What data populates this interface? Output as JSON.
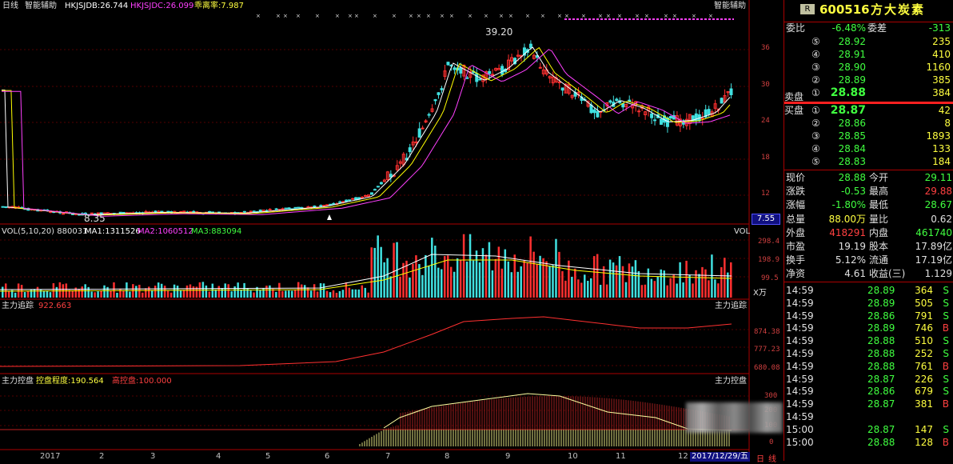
{
  "chart": {
    "period_label": "日线",
    "assist_label": "智能辅助",
    "indicator1": "HKJSJDB:26.744",
    "indicator2": "HKJSJDC:26.099",
    "indicator3": "乖离率:7.987",
    "right_label": "智能辅助",
    "high_marker": "39.20",
    "low_marker": "8.35",
    "price_axis": [
      "36",
      "30",
      "24",
      "18",
      "12"
    ],
    "last_price_box": "7.55",
    "colors": {
      "up": "#ff3030",
      "down": "#40e0e0",
      "ma1": "#ffffff",
      "ma2": "#ffff00",
      "ma3": "#ff40ff",
      "ma4": "#40ff40"
    }
  },
  "vol": {
    "title": "VOL(5,10,20) 880031",
    "ma1": "MA1:1311526",
    "ma2": "MA2:1060512",
    "ma3": "MA3:883094",
    "right_label": "VOL",
    "axis": [
      "298.4",
      "198.9",
      "99.5"
    ],
    "unit": "万"
  },
  "track": {
    "title": "主力追踪",
    "value": "922.663",
    "right_label": "主力追踪",
    "axis": [
      "874.38",
      "777.23",
      "680.08"
    ]
  },
  "control": {
    "title": "主力控盘",
    "degree": "控盘程度:190.564",
    "high": "高控盘:100.000",
    "right_label": "主力控盘",
    "axis": [
      "300",
      "200",
      "100",
      "0"
    ]
  },
  "xaxis": {
    "months": [
      "2017",
      "2",
      "3",
      "4",
      "5",
      "6",
      "7",
      "8",
      "9",
      "10",
      "11",
      "12"
    ],
    "cursor_date": "2017/12/29/五",
    "tabs": [
      "日",
      "线"
    ]
  },
  "quote": {
    "badge": "R",
    "code": "600516",
    "name": "方大炭素",
    "weibi_label": "委比",
    "weibi_value": "-6.48%",
    "weicha_label": "委差",
    "weicha_value": "-313",
    "sell": [
      {
        "lvl": "⑤",
        "price": "28.92",
        "vol": "235"
      },
      {
        "lvl": "④",
        "price": "28.91",
        "vol": "410"
      },
      {
        "lvl": "③",
        "price": "28.90",
        "vol": "1160"
      },
      {
        "lvl": "②",
        "price": "28.89",
        "vol": "385"
      },
      {
        "lvl": "①",
        "price": "28.88",
        "vol": "384"
      }
    ],
    "buy": [
      {
        "lvl": "①",
        "price": "28.87",
        "vol": "42"
      },
      {
        "lvl": "②",
        "price": "28.86",
        "vol": "8"
      },
      {
        "lvl": "③",
        "price": "28.85",
        "vol": "1893"
      },
      {
        "lvl": "④",
        "price": "28.84",
        "vol": "133"
      },
      {
        "lvl": "⑤",
        "price": "28.83",
        "vol": "184"
      }
    ],
    "sell_label": "卖盘",
    "buy_label": "买盘",
    "stats": [
      {
        "l1": "现价",
        "v1": "28.88",
        "l2": "今开",
        "v2": "29.11"
      },
      {
        "l1": "涨跌",
        "v1": "-0.53",
        "l2": "最高",
        "v2": "29.88"
      },
      {
        "l1": "涨幅",
        "v1": "-1.80%",
        "l2": "最低",
        "v2": "28.67"
      },
      {
        "l1": "总量",
        "v1": "88.00万",
        "l2": "量比",
        "v2": "0.62"
      },
      {
        "l1": "外盘",
        "v1": "418291",
        "l2": "内盘",
        "v2": "461740"
      },
      {
        "l1": "市盈",
        "v1": "19.19",
        "l2": "股本",
        "v2": "17.89亿"
      },
      {
        "l1": "换手",
        "v1": "5.12%",
        "l2": "流通",
        "v2": "17.19亿"
      },
      {
        "l1": "净资",
        "v1": "4.61",
        "l2": "收益(三)",
        "v2": "1.129"
      }
    ],
    "ticks": [
      {
        "t": "14:59",
        "p": "28.89",
        "v": "364",
        "s": "S"
      },
      {
        "t": "14:59",
        "p": "28.89",
        "v": "505",
        "s": "S"
      },
      {
        "t": "14:59",
        "p": "28.86",
        "v": "791",
        "s": "S"
      },
      {
        "t": "14:59",
        "p": "28.89",
        "v": "746",
        "s": "B"
      },
      {
        "t": "14:59",
        "p": "28.88",
        "v": "510",
        "s": "S"
      },
      {
        "t": "14:59",
        "p": "28.88",
        "v": "252",
        "s": "S"
      },
      {
        "t": "14:59",
        "p": "28.88",
        "v": "761",
        "s": "B"
      },
      {
        "t": "14:59",
        "p": "28.87",
        "v": "226",
        "s": "S"
      },
      {
        "t": "14:59",
        "p": "28.86",
        "v": "679",
        "s": "S"
      },
      {
        "t": "14:59",
        "p": "28.87",
        "v": "381",
        "s": "B"
      },
      {
        "t": "14:59",
        "p": "",
        "v": "",
        "s": ""
      },
      {
        "t": "15:00",
        "p": "28.87",
        "v": "147",
        "s": "S"
      },
      {
        "t": "15:00",
        "p": "28.88",
        "v": "128",
        "s": "B"
      }
    ]
  }
}
